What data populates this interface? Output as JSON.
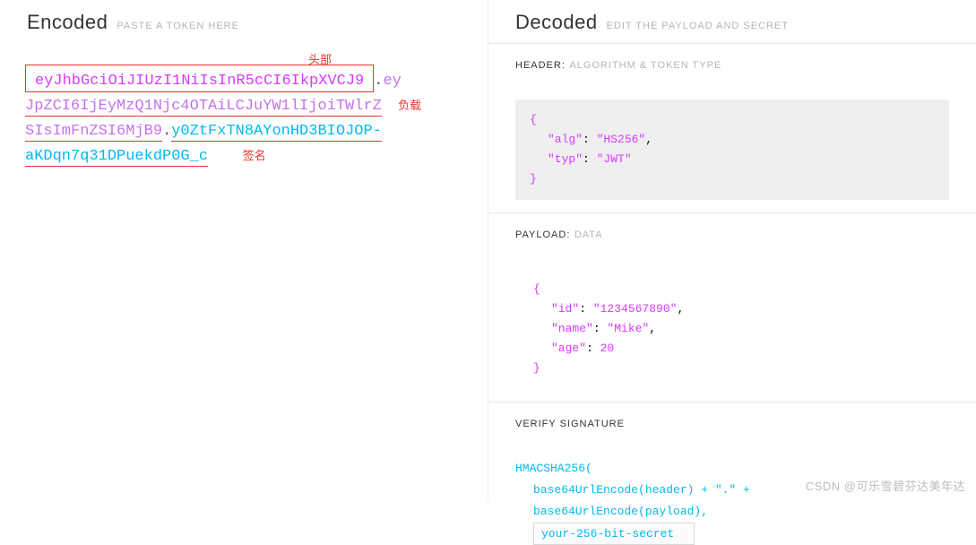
{
  "encoded": {
    "title": "Encoded",
    "subtitle": "PASTE A TOKEN HERE",
    "annotations": {
      "header": "头部",
      "payload": "负载",
      "signature": "签名"
    },
    "token": {
      "header": "eyJhbGciOiJIUzI1NiIsInR5cCI6IkpXVCJ9",
      "payload_line1": "ey",
      "payload_line2": "JpZCI6IjEyMzQ1Njc4OTAiLCJuYW1lIjoiTWlrZ",
      "payload_line3": "SIsImFnZSI6MjB9",
      "sig_line1": "y0ZtFxTN8AYonHD3BIOJOP-",
      "sig_line2": "aKDqn7q31DPuekdP0G_c"
    }
  },
  "decoded": {
    "title": "Decoded",
    "subtitle": "EDIT THE PAYLOAD AND SECRET",
    "header_section": {
      "title": "HEADER:",
      "sub": "ALGORITHM & TOKEN TYPE"
    },
    "payload_section": {
      "title": "PAYLOAD:",
      "sub": "DATA"
    },
    "signature_section": {
      "title": "VERIFY SIGNATURE"
    },
    "header_json": {
      "alg_key": "\"alg\"",
      "alg_val": "\"HS256\"",
      "typ_key": "\"typ\"",
      "typ_val": "\"JWT\""
    },
    "payload_json": {
      "id_key": "\"id\"",
      "id_val": "\"1234567890\"",
      "name_key": "\"name\"",
      "name_val": "\"Mike\"",
      "age_key": "\"age\"",
      "age_val": "20"
    },
    "signature": {
      "fn": "HMACSHA256(",
      "l1": "base64UrlEncode(header) + \".\" +",
      "l2": "base64UrlEncode(payload),",
      "secret": "your-256-bit-secret"
    }
  },
  "watermark": "CSDN @可乐雪碧芬达美年达"
}
